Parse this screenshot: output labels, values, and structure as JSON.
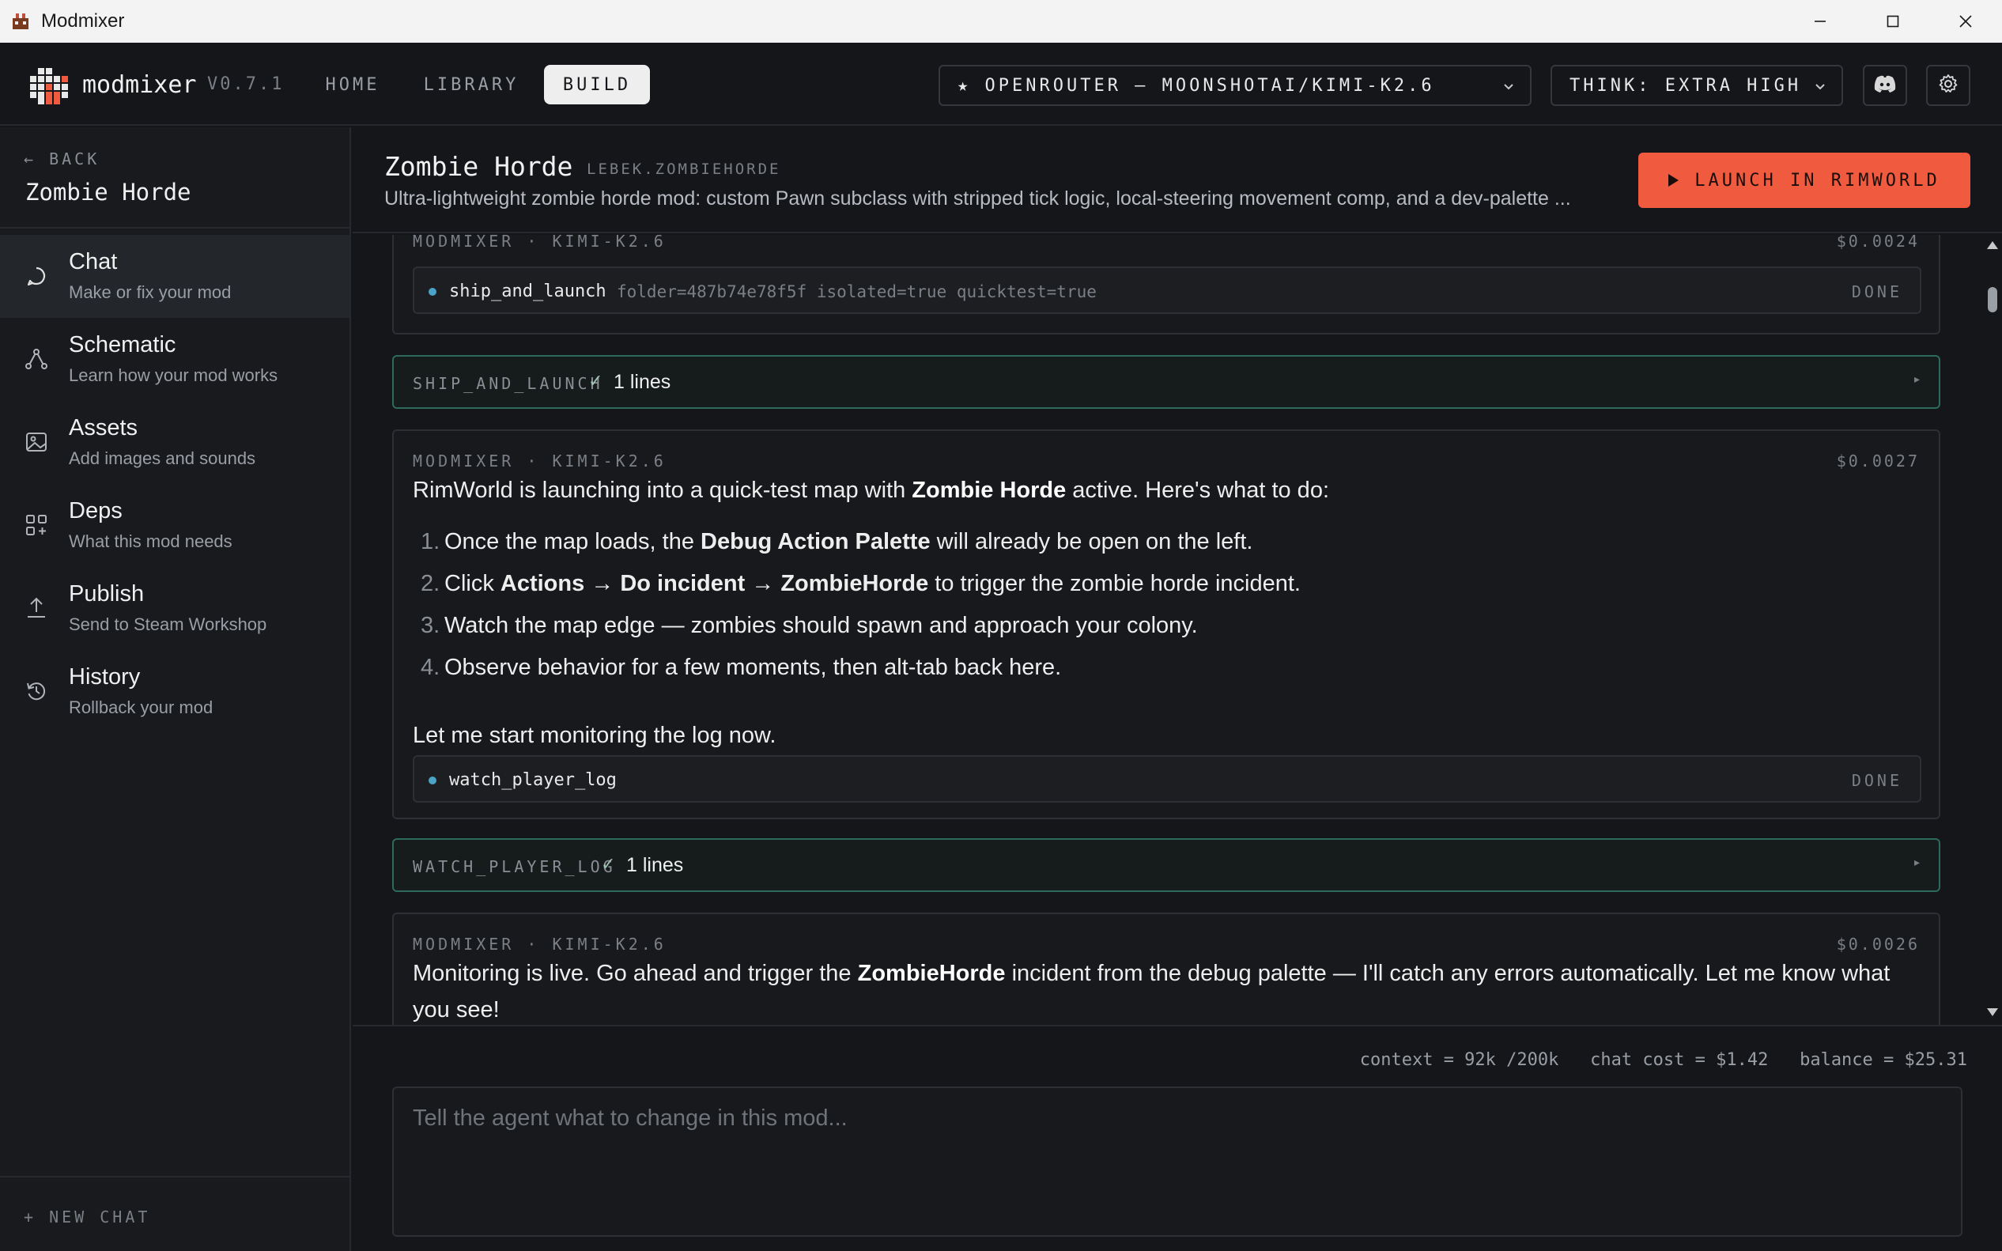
{
  "window": {
    "title": "Modmixer"
  },
  "header": {
    "brand": "modmixer",
    "version": "V0.7.1",
    "nav": {
      "home": "HOME",
      "library": "LIBRARY",
      "build": "BUILD"
    },
    "model_select": "★ OPENROUTER — MOONSHOTAI/KIMI-K2.6",
    "think_select": "THINK: EXTRA HIGH"
  },
  "sidebar": {
    "back": "← BACK",
    "mod_name": "Zombie Horde",
    "items": [
      {
        "label": "Chat",
        "sub": "Make or fix your mod"
      },
      {
        "label": "Schematic",
        "sub": "Learn how your mod works"
      },
      {
        "label": "Assets",
        "sub": "Add images and sounds"
      },
      {
        "label": "Deps",
        "sub": "What this mod needs"
      },
      {
        "label": "Publish",
        "sub": "Send to Steam Workshop"
      },
      {
        "label": "History",
        "sub": "Rollback your mod"
      }
    ],
    "new_chat": "+ NEW CHAT"
  },
  "mod": {
    "title": "Zombie Horde",
    "id": "LEBEK.ZOMBIEHORDE",
    "description": "Ultra-lightweight zombie horde mod: custom Pawn subclass with stripped tick logic, local-steering movement comp, and a dev-palette ...",
    "launch": "LAUNCH IN RIMWORLD"
  },
  "chat": {
    "card1": {
      "header": "MODMIXER · KIMI-K2.6",
      "cost": "$0.0024",
      "tool_name": "ship_and_launch",
      "tool_args": "folder=487b74e78f5f isolated=true quicktest=true",
      "tool_status": "DONE"
    },
    "result1": {
      "name": "SHIP_AND_LAUNCH",
      "check": "✓",
      "text": "1 lines"
    },
    "card2": {
      "header": "MODMIXER · KIMI-K2.6",
      "cost": "$0.0027",
      "intro": {
        "a": "RimWorld is launching into a quick-test map with ",
        "b": "Zombie Horde",
        "c": " active. Here's what to do:"
      },
      "steps": [
        {
          "num": "1.",
          "a": "Once the map loads, the ",
          "b": "Debug Action Palette",
          "c": " will already be open on the left."
        },
        {
          "num": "2.",
          "a": "Click ",
          "b": "Actions → Do incident → ZombieHorde",
          "c": " to trigger the zombie horde incident."
        },
        {
          "num": "3.",
          "a": "Watch the map edge — zombies should spawn and approach your colony."
        },
        {
          "num": "4.",
          "a": "Observe behavior for a few moments, then alt-tab back here."
        }
      ],
      "outro": "Let me start monitoring the log now.",
      "tool_name": "watch_player_log",
      "tool_status": "DONE"
    },
    "result2": {
      "name": "WATCH_PLAYER_LOG",
      "check": "✓",
      "text": "1 lines"
    },
    "card3": {
      "header": "MODMIXER · KIMI-K2.6",
      "cost": "$0.0026",
      "text": {
        "a": "Monitoring is live. Go ahead and trigger the ",
        "b": "ZombieHorde",
        "c": " incident from the debug palette — I'll catch any errors automatically. Let me know what you see!"
      }
    }
  },
  "footer": {
    "context": "context = 92k /200k",
    "chat_cost": "chat cost = $1.42",
    "balance": "balance = $25.31",
    "placeholder": "Tell the agent what to change in this mod..."
  },
  "colors": {
    "accent": "#f05a3f",
    "result_border": "#2e6a5c",
    "tool_dot": "#4ba3c7"
  }
}
